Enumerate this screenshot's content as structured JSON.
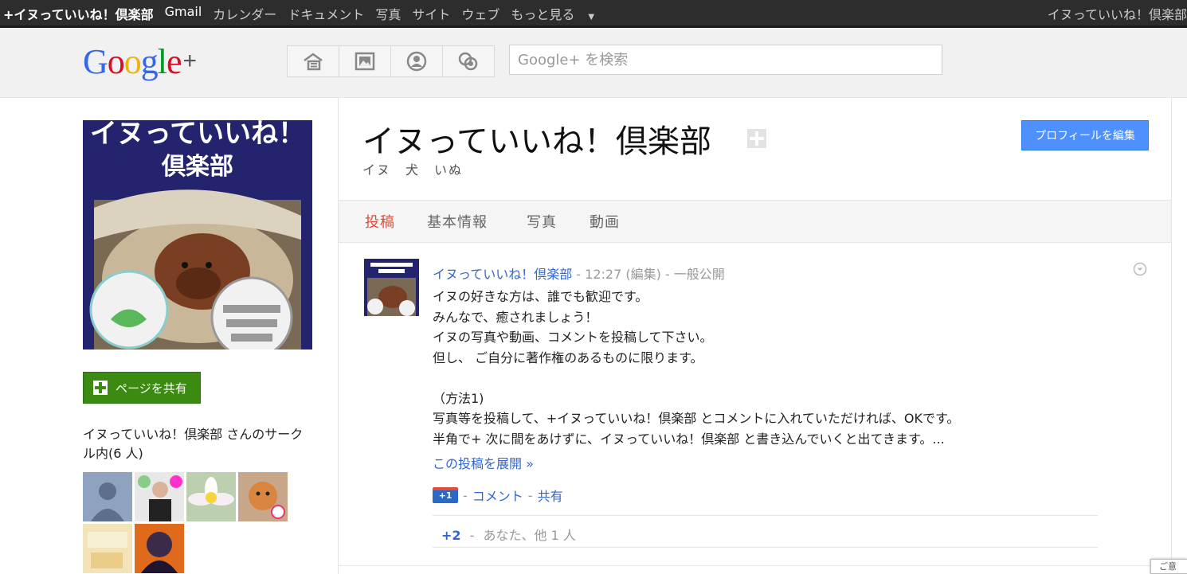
{
  "topbar": {
    "items": [
      {
        "label": "+イヌっていいね！倶楽部",
        "active": true
      },
      {
        "label": "Gmail"
      },
      {
        "label": "カレンダー"
      },
      {
        "label": "ドキュメント"
      },
      {
        "label": "写真"
      },
      {
        "label": "サイト"
      },
      {
        "label": "ウェブ"
      },
      {
        "label": "もっと見る"
      }
    ],
    "account_name": "イヌっていいね！倶楽部"
  },
  "header": {
    "logo_text": "Google",
    "logo_plus": "+",
    "search_placeholder": "Google+ を検索"
  },
  "profile": {
    "image_text_line1": "イヌっていいね！",
    "image_text_line2": "倶楽部",
    "share_button": "ページを共有",
    "circles_text": "イヌっていいね！倶楽部 さんのサークル内(6 人)"
  },
  "page": {
    "title": "イヌっていいね！倶楽部",
    "subtitle": "イヌ　犬　いぬ",
    "edit_button": "プロフィールを編集",
    "tabs": [
      "投稿",
      "基本情報",
      "写真",
      "動画"
    ]
  },
  "post": {
    "author": "イヌっていいね！倶楽部",
    "time_meta": " - 12:27 (編集) - 一般公開",
    "body": "イヌの好きな方は、誰でも歓迎です。\nみんなで、癒されましょう！\nイヌの写真や動画、コメントを投稿して下さい。\n但し、 ご自分に著作権のあるものに限ります。\n\n（方法1)\n写真等を投稿して、+イヌっていいね！倶楽部  とコメントに入れていただければ、OKです。\n半角で+  次に間をあけずに、イヌっていいね！倶楽部  と書き込んでいくと出てきます。...",
    "expand": "この投稿を展開 »",
    "plusone_label": "+1",
    "comment": "コメント",
    "share": "共有",
    "plus_count": "+2",
    "plus_meta": "あなた、他 1 人",
    "sep": "-"
  },
  "corner_text": "ご意"
}
